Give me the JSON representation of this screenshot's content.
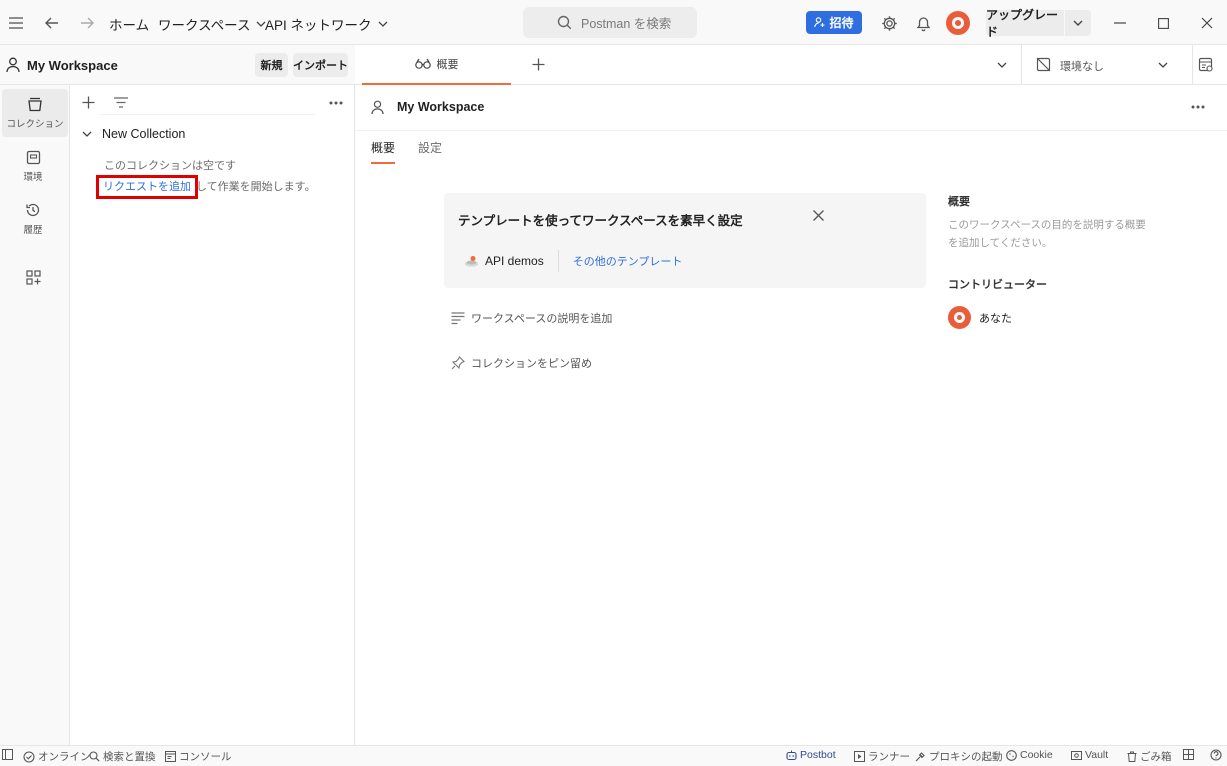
{
  "titlebar": {
    "nav": {
      "home": "ホーム",
      "workspaces": "ワークスペース",
      "api_network": "API ネットワーク"
    },
    "search_placeholder": "Postman を検索",
    "invite_label": "招待",
    "upgrade_label": "アップグレード"
  },
  "rail": {
    "items": [
      {
        "label": "コレクション",
        "icon": "collections-icon"
      },
      {
        "label": "環境",
        "icon": "environment-icon"
      },
      {
        "label": "履歴",
        "icon": "history-icon"
      },
      {
        "label": "",
        "icon": "apps-icon"
      }
    ]
  },
  "workspace": {
    "title": "My Workspace",
    "new_label": "新規",
    "import_label": "インポート"
  },
  "sidebar": {
    "collection_name": "New Collection",
    "empty_line1": "このコレクションは空です",
    "add_request": "リクエストを追加",
    "empty_line2_rest": "して作業を開始します。"
  },
  "tabs": {
    "overview_tab": "概要",
    "environment": "環境なし"
  },
  "main": {
    "workspace_title": "My Workspace",
    "subtabs": [
      "概要",
      "設定"
    ],
    "template_card": {
      "title": "テンプレートを使ってワークスペースを素早く設定",
      "api_demos": "API demos",
      "other_templates": "その他のテンプレート"
    },
    "add_description": "ワークスペースの説明を追加",
    "pin_collections": "コレクションをピン留め"
  },
  "side_info": {
    "overview_heading": "概要",
    "overview_text_1": "このワークスペースの目的を説明する概要",
    "overview_text_2": "を追加してください。",
    "contributors_heading": "コントリビューター",
    "contributor_name": "あなた"
  },
  "statusbar": {
    "online": "オンライン",
    "find_replace": "検索と置換",
    "console": "コンソール",
    "postbot": "Postbot",
    "runner": "ランナー",
    "proxy": "プロキシの起動",
    "cookie": "Cookie",
    "vault": "Vault",
    "trash": "ごみ箱"
  },
  "colors": {
    "accent": "#f26b3a",
    "primary_button": "#2f6ee0",
    "highlight_box": "#e00000"
  }
}
